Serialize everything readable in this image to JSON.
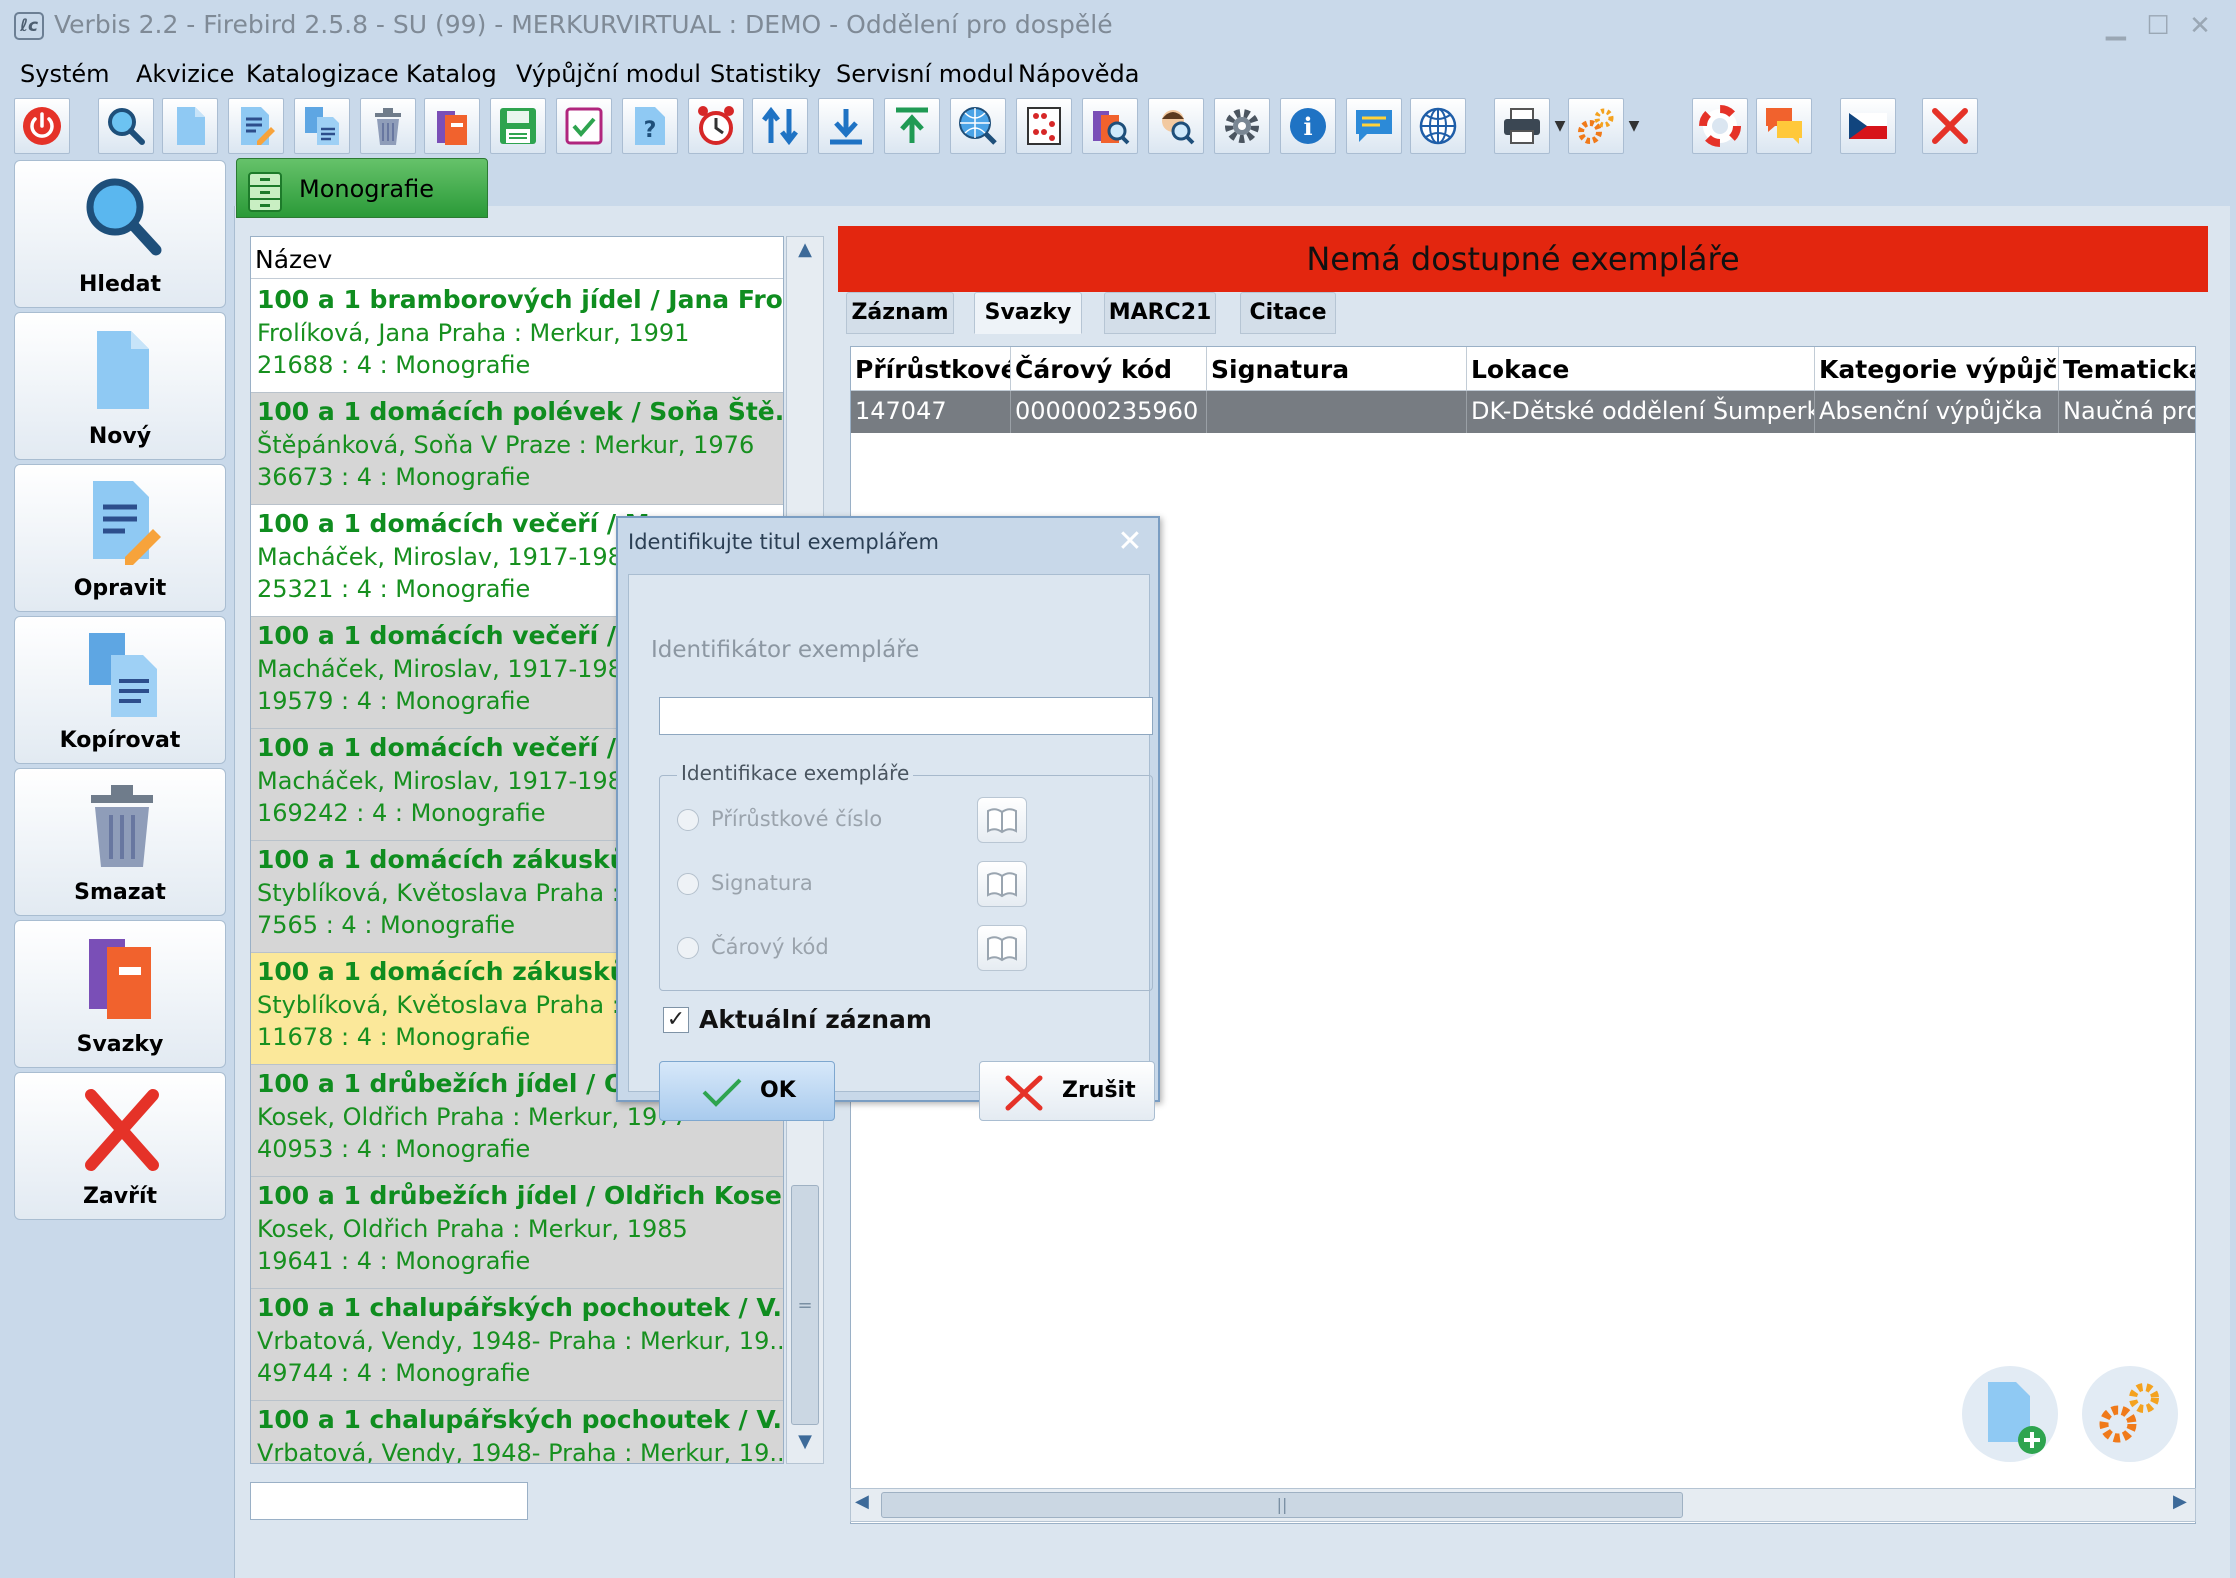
{
  "window": {
    "title": "Verbis 2.2 - Firebird 2.5.8 - SU (99) - MERKURVIRTUAL : DEMO - Oddělení pro dospělé",
    "app_icon": "ℓc"
  },
  "menu": [
    "Systém",
    "Akvizice",
    "Katalogizace",
    "Katalog",
    "Výpůjční modul",
    "Statistiky",
    "Servisní modul",
    "Nápověda"
  ],
  "toolbar": [
    "power-icon",
    "search-icon",
    "new-document-icon",
    "edit-icon",
    "copy-icon",
    "trash-icon",
    "books-icon",
    "save-icon",
    "checkbox-icon",
    "help-document-icon",
    "alarm-clock-icon",
    "sort-icon",
    "download-icon",
    "upload-icon",
    "web-search-icon",
    "abacus-icon",
    "book-search-icon",
    "user-search-icon",
    "settings-icon",
    "info-icon",
    "chat-icon",
    "globe-icon",
    "printer-icon",
    "gears-icon",
    "lifebuoy-icon",
    "messages-icon",
    "czech-flag-icon",
    "close-icon"
  ],
  "sidebar": {
    "search": "Hledat",
    "new": "Nový",
    "edit": "Opravit",
    "copy": "Kopírovat",
    "delete": "Smazat",
    "volumes": "Svazky",
    "close": "Zavřít"
  },
  "tab": {
    "label": "Monografie"
  },
  "list": {
    "header": "Název",
    "rows": [
      {
        "title": "100 a 1 bramborových jídel / Jana Fro...",
        "author": "Frolíková, Jana Praha : Merkur, 1991",
        "number": "21688 : 4 : Monografie"
      },
      {
        "title": "100 a 1 domácích polévek / Soňa Ště...",
        "author": "Štěpánková, Soňa V Praze : Merkur, 1976",
        "number": "36673 : 4 : Monografie"
      },
      {
        "title": "100 a 1 domácích večeří / M",
        "author": "Macháček, Miroslav, 1917-1988",
        "number": "25321 : 4 : Monografie"
      },
      {
        "title": "100 a 1 domácích večeří / M",
        "author": "Macháček, Miroslav, 1917-1988",
        "number": "19579 : 4 : Monografie"
      },
      {
        "title": "100 a 1 domácích večeří / M",
        "author": "Macháček, Miroslav, 1917-1988",
        "number": "169242 : 4 : Monografie"
      },
      {
        "title": "100 a 1 domácích zákusků /",
        "author": "Styblíková, Květoslava Praha : M",
        "number": "7565 : 4 : Monografie"
      },
      {
        "title": "100 a 1 domácích zákusků /",
        "author": "Styblíková, Květoslava Praha : M",
        "number": "11678 : 4 : Monografie"
      },
      {
        "title": "100 a 1 drůbežích jídel / Old",
        "author": "Kosek, Oldřich Praha : Merkur, 1977",
        "number": "40953 : 4 : Monografie"
      },
      {
        "title": "100 a 1 drůbežích jídel / Oldřich Kosek",
        "author": "Kosek, Oldřich Praha : Merkur, 1985",
        "number": "19641 : 4 : Monografie"
      },
      {
        "title": "100 a 1 chalupářských pochoutek / V...",
        "author": "Vrbatová, Vendy, 1948- Praha : Merkur, 19...",
        "number": "49744 : 4 : Monografie"
      },
      {
        "title": "100 a 1 chalupářských pochoutek / V...",
        "author": "Vrbatová, Vendy, 1948- Praha : Merkur, 19...",
        "number": ""
      }
    ]
  },
  "banner": "Nemá dostupné exempláře",
  "detail_tabs": [
    "Záznam",
    "Svazky",
    "MARC21",
    "Citace"
  ],
  "grid": {
    "columns": [
      "Přírůstkové",
      "Čárový kód",
      "Signatura",
      "Lokace",
      "Kategorie výpůjčk",
      "Tematická"
    ],
    "rows": [
      [
        "147047",
        "000000235960",
        "",
        "DK-Dětské oddělení Šumperk",
        "Absenční výpůjčka",
        "Naučná pro"
      ]
    ]
  },
  "dialog": {
    "title": "Identifikujte titul exemplářem",
    "field_label": "Identifikátor exempláře",
    "field_value": "",
    "group_label": "Identifikace exempláře",
    "options": [
      "Přírůstkové číslo",
      "Signatura",
      "Čárový kód"
    ],
    "current_record": "Aktuální záznam",
    "ok": "OK",
    "cancel": "Zrušit"
  },
  "colors": {
    "banner": "#e3260f",
    "list_text": "#0f8d1f",
    "highlight": "#fbe89a",
    "selected_row": "#777c82"
  }
}
